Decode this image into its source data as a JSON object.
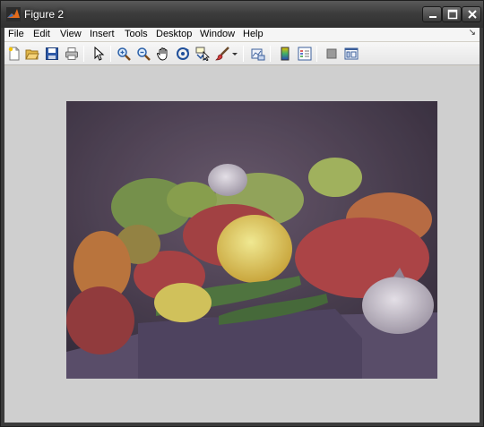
{
  "window": {
    "title": "Figure 2"
  },
  "menubar": {
    "items": [
      {
        "label": "File"
      },
      {
        "label": "Edit"
      },
      {
        "label": "View"
      },
      {
        "label": "Insert"
      },
      {
        "label": "Tools"
      },
      {
        "label": "Desktop"
      },
      {
        "label": "Window"
      },
      {
        "label": "Help"
      }
    ],
    "dock_glyph": "↘"
  },
  "toolbar": {
    "buttons": [
      {
        "icon": "new-file-icon"
      },
      {
        "icon": "open-folder-icon"
      },
      {
        "icon": "save-icon"
      },
      {
        "icon": "print-icon"
      },
      {
        "icon": "select-arrow-icon"
      },
      {
        "icon": "zoom-in-icon"
      },
      {
        "icon": "zoom-out-icon"
      },
      {
        "icon": "pan-hand-icon"
      },
      {
        "icon": "rotate-3d-icon"
      },
      {
        "icon": "data-cursor-icon"
      },
      {
        "icon": "brush-icon"
      },
      {
        "icon": "link-plot-icon"
      },
      {
        "icon": "colorbar-icon"
      },
      {
        "icon": "legend-icon"
      },
      {
        "icon": "hide-plot-tools-icon"
      },
      {
        "icon": "show-plot-tools-icon"
      }
    ]
  },
  "figure": {
    "image_subject": "peppers"
  }
}
